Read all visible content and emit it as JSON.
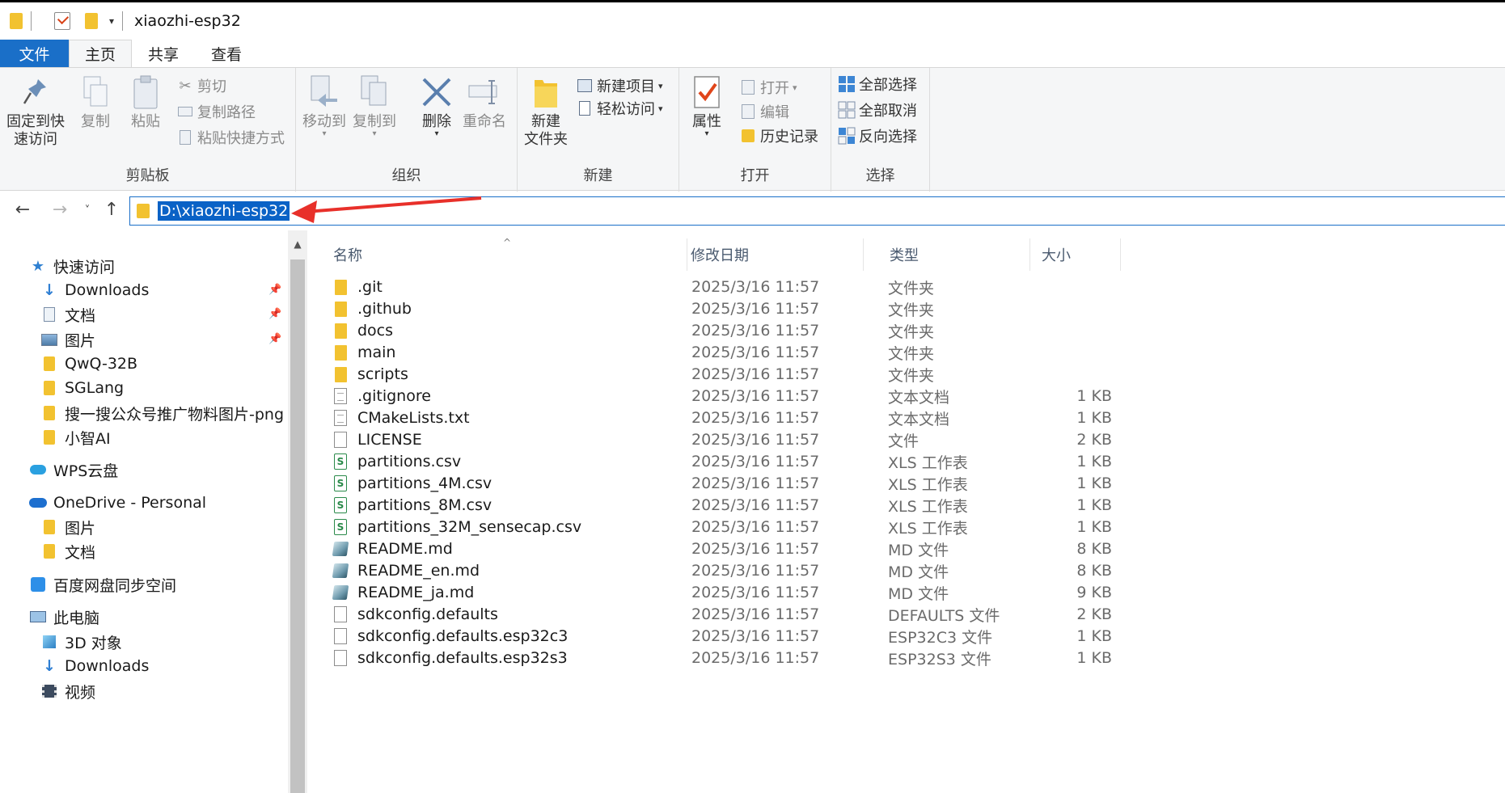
{
  "window": {
    "title": "xiaozhi-esp32"
  },
  "tabs": {
    "file": "文件",
    "home": "主页",
    "share": "共享",
    "view": "查看"
  },
  "ribbon": {
    "clipboard": {
      "label": "剪贴板",
      "pin": "固定到快\n速访问",
      "pin_l1": "固定到快",
      "pin_l2": "速访问",
      "copy": "复制",
      "paste": "粘贴",
      "cut": "剪切",
      "copy_path": "复制路径",
      "paste_shortcut": "粘贴快捷方式"
    },
    "organize": {
      "label": "组织",
      "move_to": "移动到",
      "copy_to": "复制到",
      "delete": "删除",
      "rename": "重命名"
    },
    "new": {
      "label": "新建",
      "new_folder_l1": "新建",
      "new_folder_l2": "文件夹",
      "new_item": "新建项目",
      "easy_access": "轻松访问"
    },
    "open": {
      "label": "打开",
      "properties": "属性",
      "open": "打开",
      "edit": "编辑",
      "history": "历史记录"
    },
    "select": {
      "label": "选择",
      "select_all": "全部选择",
      "select_none": "全部取消",
      "invert": "反向选择"
    }
  },
  "address": {
    "path": "D:\\xiaozhi-esp32"
  },
  "nav": {
    "quick_access": "快速访问",
    "qa_items": [
      "Downloads",
      "文档",
      "图片",
      "QwQ-32B",
      "SGLang",
      "搜一搜公众号推广物料图片-png",
      "小智AI"
    ],
    "wps": "WPS云盘",
    "onedrive": "OneDrive - Personal",
    "od_items": [
      "图片",
      "文档"
    ],
    "baidu": "百度网盘同步空间",
    "this_pc": "此电脑",
    "pc_items": [
      "3D 对象",
      "Downloads",
      "视频"
    ]
  },
  "columns": {
    "name": "名称",
    "date": "修改日期",
    "type": "类型",
    "size": "大小"
  },
  "files": [
    {
      "name": ".git",
      "date": "2025/3/16 11:57",
      "type": "文件夹",
      "size": "",
      "icon": "folder"
    },
    {
      "name": ".github",
      "date": "2025/3/16 11:57",
      "type": "文件夹",
      "size": "",
      "icon": "folder"
    },
    {
      "name": "docs",
      "date": "2025/3/16 11:57",
      "type": "文件夹",
      "size": "",
      "icon": "folder"
    },
    {
      "name": "main",
      "date": "2025/3/16 11:57",
      "type": "文件夹",
      "size": "",
      "icon": "folder"
    },
    {
      "name": "scripts",
      "date": "2025/3/16 11:57",
      "type": "文件夹",
      "size": "",
      "icon": "folder"
    },
    {
      "name": ".gitignore",
      "date": "2025/3/16 11:57",
      "type": "文本文档",
      "size": "1 KB",
      "icon": "doc"
    },
    {
      "name": "CMakeLists.txt",
      "date": "2025/3/16 11:57",
      "type": "文本文档",
      "size": "1 KB",
      "icon": "doc"
    },
    {
      "name": "LICENSE",
      "date": "2025/3/16 11:57",
      "type": "文件",
      "size": "2 KB",
      "icon": "blank"
    },
    {
      "name": "partitions.csv",
      "date": "2025/3/16 11:57",
      "type": "XLS 工作表",
      "size": "1 KB",
      "icon": "csv"
    },
    {
      "name": "partitions_4M.csv",
      "date": "2025/3/16 11:57",
      "type": "XLS 工作表",
      "size": "1 KB",
      "icon": "csv"
    },
    {
      "name": "partitions_8M.csv",
      "date": "2025/3/16 11:57",
      "type": "XLS 工作表",
      "size": "1 KB",
      "icon": "csv"
    },
    {
      "name": "partitions_32M_sensecap.csv",
      "date": "2025/3/16 11:57",
      "type": "XLS 工作表",
      "size": "1 KB",
      "icon": "csv"
    },
    {
      "name": "README.md",
      "date": "2025/3/16 11:57",
      "type": "MD 文件",
      "size": "8 KB",
      "icon": "md"
    },
    {
      "name": "README_en.md",
      "date": "2025/3/16 11:57",
      "type": "MD 文件",
      "size": "8 KB",
      "icon": "md"
    },
    {
      "name": "README_ja.md",
      "date": "2025/3/16 11:57",
      "type": "MD 文件",
      "size": "9 KB",
      "icon": "md"
    },
    {
      "name": "sdkconfig.defaults",
      "date": "2025/3/16 11:57",
      "type": "DEFAULTS 文件",
      "size": "2 KB",
      "icon": "blank"
    },
    {
      "name": "sdkconfig.defaults.esp32c3",
      "date": "2025/3/16 11:57",
      "type": "ESP32C3 文件",
      "size": "1 KB",
      "icon": "blank"
    },
    {
      "name": "sdkconfig.defaults.esp32s3",
      "date": "2025/3/16 11:57",
      "type": "ESP32S3 文件",
      "size": "1 KB",
      "icon": "blank"
    }
  ],
  "colors": {
    "accent": "#1a6fc8",
    "selection": "#0a62c6",
    "folder": "#f2c230",
    "annotation_arrow": "#e8302a"
  }
}
